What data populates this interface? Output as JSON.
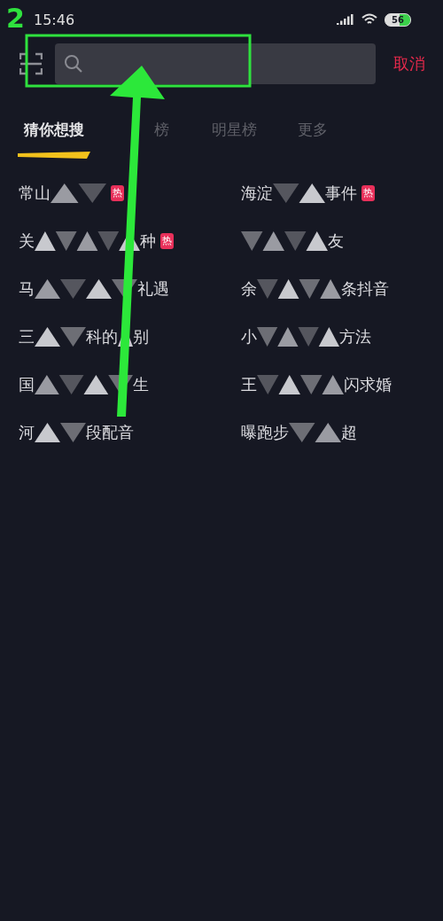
{
  "annotation": {
    "step": "2"
  },
  "status_bar": {
    "time": "15:46",
    "battery": "56"
  },
  "search": {
    "cancel": "取消"
  },
  "tabs": [
    {
      "label": "猜你想搜",
      "selected": true
    },
    {
      "label": "榜",
      "selected": false
    },
    {
      "label": "明星榜",
      "selected": false
    },
    {
      "label": "更多",
      "selected": false
    }
  ],
  "suggestions": [
    {
      "tag": "热",
      "segments": [
        {
          "kind": "text",
          "text": "常山"
        },
        {
          "kind": "mosaic"
        }
      ]
    },
    {
      "tag": "热",
      "segments": [
        {
          "kind": "text",
          "text": "海淀"
        },
        {
          "kind": "mosaic"
        },
        {
          "kind": "text",
          "text": "事件"
        }
      ]
    },
    {
      "tag": "热",
      "segments": [
        {
          "kind": "text",
          "text": "关"
        },
        {
          "kind": "mosaic"
        },
        {
          "kind": "text",
          "text": "种"
        }
      ]
    },
    {
      "segments": [
        {
          "kind": "mosaic"
        },
        {
          "kind": "text",
          "text": "友"
        }
      ]
    },
    {
      "segments": [
        {
          "kind": "text",
          "text": "马"
        },
        {
          "kind": "mosaic"
        },
        {
          "kind": "text",
          "text": "礼遇"
        }
      ]
    },
    {
      "segments": [
        {
          "kind": "text",
          "text": "余"
        },
        {
          "kind": "mosaic"
        },
        {
          "kind": "text",
          "text": "条抖音"
        }
      ]
    },
    {
      "segments": [
        {
          "kind": "text",
          "text": "三"
        },
        {
          "kind": "mosaic"
        },
        {
          "kind": "text",
          "text": "科的"
        },
        {
          "kind": "mosaic"
        },
        {
          "kind": "text",
          "text": "别"
        }
      ]
    },
    {
      "segments": [
        {
          "kind": "text",
          "text": "小"
        },
        {
          "kind": "mosaic"
        },
        {
          "kind": "text",
          "text": "方法"
        }
      ]
    },
    {
      "segments": [
        {
          "kind": "text",
          "text": "国"
        },
        {
          "kind": "mosaic"
        },
        {
          "kind": "text",
          "text": "生"
        }
      ]
    },
    {
      "segments": [
        {
          "kind": "text",
          "text": "王"
        },
        {
          "kind": "mosaic"
        },
        {
          "kind": "text",
          "text": "闪求婚"
        }
      ]
    },
    {
      "segments": [
        {
          "kind": "text",
          "text": "河"
        },
        {
          "kind": "mosaic"
        },
        {
          "kind": "text",
          "text": "段配音"
        }
      ]
    },
    {
      "segments": [
        {
          "kind": "text",
          "text": "曝跑步"
        },
        {
          "kind": "mosaic"
        },
        {
          "kind": "text",
          "text": "超"
        }
      ]
    }
  ]
}
